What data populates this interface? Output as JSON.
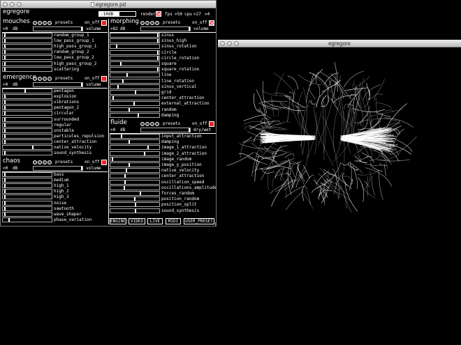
{
  "main_window": {
    "title": "egregore.pd",
    "app_label": "egregore",
    "master_db": "-10dB",
    "master_level": 0.55,
    "render_label": "render",
    "fps_label": "fps",
    "fps_value": ">50",
    "cpu_label": "cpu",
    "cpu_value": ">27",
    "extra_value": ">4"
  },
  "sections": {
    "mouches": {
      "title": "mouches",
      "presets_label": "presets",
      "onoff_label": "on_off",
      "db_value": ">0",
      "db_unit": "dB",
      "volume_label": "volume",
      "params": [
        {
          "label": "random_group_1",
          "value": 0.03
        },
        {
          "label": "low_pass_group_1",
          "value": 0.03
        },
        {
          "label": "high_pass_group_1",
          "value": 0.03
        },
        {
          "label": "random_group_2",
          "value": 0.03
        },
        {
          "label": "low_pass_group_2",
          "value": 0.03
        },
        {
          "label": "high_pass_group_2",
          "value": 0.03
        },
        {
          "label": "scattering",
          "value": 0.03
        }
      ]
    },
    "morphing": {
      "title": "morphing",
      "presets_label": "presets",
      "onoff_label": "on_off",
      "db_value": ">82",
      "db_unit": "dB",
      "volume_label": "volume",
      "params": [
        {
          "label": "sinus",
          "value": 0.98
        },
        {
          "label": "sinus_high",
          "value": 0.98
        },
        {
          "label": "sinus_rotation",
          "value": 0.12
        },
        {
          "label": "circle",
          "value": 0.98
        },
        {
          "label": "circle_rotation",
          "value": 0.98
        },
        {
          "label": "square",
          "value": 0.2
        },
        {
          "label": "square_rotation",
          "value": 0.98
        },
        {
          "label": "line",
          "value": 0.34
        },
        {
          "label": "line_rotation",
          "value": 0.25
        },
        {
          "label": "sinus_vertical",
          "value": 0.14
        },
        {
          "label": "grid",
          "value": 0.52
        },
        {
          "label": "center_attraction",
          "value": 0.05
        },
        {
          "label": "external_attraction",
          "value": 0.48
        },
        {
          "label": "random",
          "value": 0.38
        },
        {
          "label": "damping",
          "value": 0.57
        }
      ]
    },
    "emergence": {
      "title": "emergence",
      "presets_label": "presets",
      "onoff_label": "on_off",
      "db_value": ">0",
      "db_unit": "dB",
      "volume_label": "volume",
      "params": [
        {
          "label": "pentagon",
          "value": 0.45
        },
        {
          "label": "explosion",
          "value": 0.03
        },
        {
          "label": "vibrations",
          "value": 0.03
        },
        {
          "label": "pentagon_2",
          "value": 0.03
        },
        {
          "label": "circular",
          "value": 0.03
        },
        {
          "label": "surrounded",
          "value": 0.03
        },
        {
          "label": "regular",
          "value": 0.03
        },
        {
          "label": "unstable",
          "value": 0.03
        },
        {
          "label": "particules_repulsion",
          "value": 0.03
        },
        {
          "label": "center_attraction",
          "value": 0.03
        },
        {
          "label": "native_velocity",
          "value": 0.62
        },
        {
          "label": "sound_synthesis",
          "value": 0.03
        }
      ]
    },
    "chaos": {
      "title": "chaos",
      "presets_label": "presets",
      "onoff_label": "on_off",
      "db_value": ">0",
      "db_unit": "dB",
      "volume_label": "volume",
      "params": [
        {
          "label": "bass",
          "value": 0.03
        },
        {
          "label": "medium",
          "value": 0.03
        },
        {
          "label": "high_1",
          "value": 0.03
        },
        {
          "label": "high_2",
          "value": 0.03
        },
        {
          "label": "high_3",
          "value": 0.03
        },
        {
          "label": "noise",
          "value": 0.03
        },
        {
          "label": "sawtooth",
          "value": 0.03
        },
        {
          "label": "wave_shaper",
          "value": 0.03
        },
        {
          "label": "phase_variation",
          "value": 0.12
        }
      ]
    },
    "fluide": {
      "title": "fluide",
      "presets_label": "presets",
      "onoff_label": "on_off",
      "db_value": ">0",
      "db_unit": "dB",
      "drywet_label": "dry/wet",
      "params": [
        {
          "label": "input_attraction",
          "value": 0.22
        },
        {
          "label": "damping",
          "value": 0.38
        },
        {
          "label": "image_1_attraction",
          "value": 0.78
        },
        {
          "label": "image_2_attraction",
          "value": 0.7
        },
        {
          "label": "image_random",
          "value": 0.03
        },
        {
          "label": "image_y_position",
          "value": 0.38
        },
        {
          "label": "native_velocity",
          "value": 0.33
        },
        {
          "label": "center_attraction",
          "value": 0.3
        },
        {
          "label": "oscillation_speed",
          "value": 0.3
        },
        {
          "label": "oscillations_amplitude",
          "value": 0.28
        },
        {
          "label": "forces_random",
          "value": 0.62
        },
        {
          "label": "position_random",
          "value": 0.5
        },
        {
          "label": "position_split",
          "value": 0.52
        },
        {
          "label": "sound_synthesis",
          "value": 0.52
        }
      ]
    }
  },
  "bottom_buttons": [
    "ENGINE",
    "VIDEO",
    "LIVE",
    "MIDI",
    "USER_PRESET"
  ],
  "gem_window": {
    "title": "egregore"
  }
}
